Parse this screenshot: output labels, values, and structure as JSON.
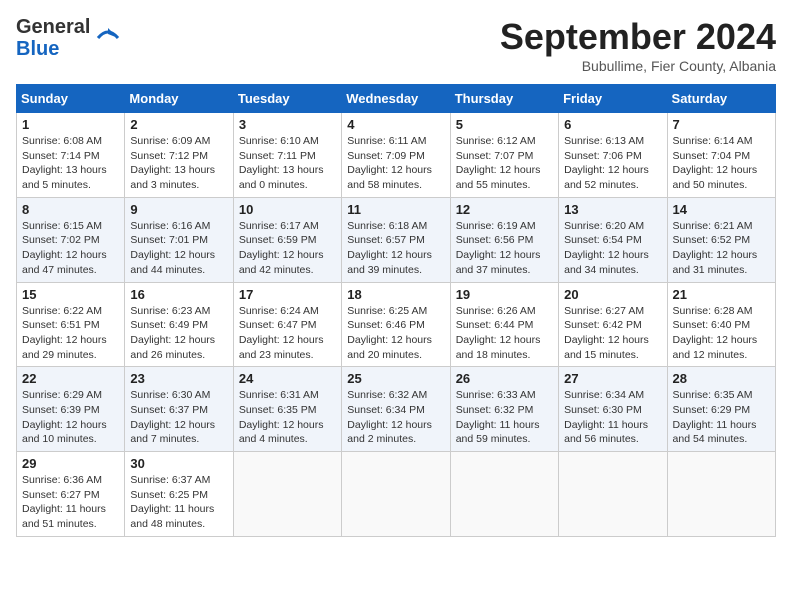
{
  "header": {
    "logo_general": "General",
    "logo_blue": "Blue",
    "month": "September 2024",
    "location": "Bubullime, Fier County, Albania"
  },
  "columns": [
    "Sunday",
    "Monday",
    "Tuesday",
    "Wednesday",
    "Thursday",
    "Friday",
    "Saturday"
  ],
  "weeks": [
    [
      {
        "day": "1",
        "info": "Sunrise: 6:08 AM\nSunset: 7:14 PM\nDaylight: 13 hours\nand 5 minutes."
      },
      {
        "day": "2",
        "info": "Sunrise: 6:09 AM\nSunset: 7:12 PM\nDaylight: 13 hours\nand 3 minutes."
      },
      {
        "day": "3",
        "info": "Sunrise: 6:10 AM\nSunset: 7:11 PM\nDaylight: 13 hours\nand 0 minutes."
      },
      {
        "day": "4",
        "info": "Sunrise: 6:11 AM\nSunset: 7:09 PM\nDaylight: 12 hours\nand 58 minutes."
      },
      {
        "day": "5",
        "info": "Sunrise: 6:12 AM\nSunset: 7:07 PM\nDaylight: 12 hours\nand 55 minutes."
      },
      {
        "day": "6",
        "info": "Sunrise: 6:13 AM\nSunset: 7:06 PM\nDaylight: 12 hours\nand 52 minutes."
      },
      {
        "day": "7",
        "info": "Sunrise: 6:14 AM\nSunset: 7:04 PM\nDaylight: 12 hours\nand 50 minutes."
      }
    ],
    [
      {
        "day": "8",
        "info": "Sunrise: 6:15 AM\nSunset: 7:02 PM\nDaylight: 12 hours\nand 47 minutes."
      },
      {
        "day": "9",
        "info": "Sunrise: 6:16 AM\nSunset: 7:01 PM\nDaylight: 12 hours\nand 44 minutes."
      },
      {
        "day": "10",
        "info": "Sunrise: 6:17 AM\nSunset: 6:59 PM\nDaylight: 12 hours\nand 42 minutes."
      },
      {
        "day": "11",
        "info": "Sunrise: 6:18 AM\nSunset: 6:57 PM\nDaylight: 12 hours\nand 39 minutes."
      },
      {
        "day": "12",
        "info": "Sunrise: 6:19 AM\nSunset: 6:56 PM\nDaylight: 12 hours\nand 37 minutes."
      },
      {
        "day": "13",
        "info": "Sunrise: 6:20 AM\nSunset: 6:54 PM\nDaylight: 12 hours\nand 34 minutes."
      },
      {
        "day": "14",
        "info": "Sunrise: 6:21 AM\nSunset: 6:52 PM\nDaylight: 12 hours\nand 31 minutes."
      }
    ],
    [
      {
        "day": "15",
        "info": "Sunrise: 6:22 AM\nSunset: 6:51 PM\nDaylight: 12 hours\nand 29 minutes."
      },
      {
        "day": "16",
        "info": "Sunrise: 6:23 AM\nSunset: 6:49 PM\nDaylight: 12 hours\nand 26 minutes."
      },
      {
        "day": "17",
        "info": "Sunrise: 6:24 AM\nSunset: 6:47 PM\nDaylight: 12 hours\nand 23 minutes."
      },
      {
        "day": "18",
        "info": "Sunrise: 6:25 AM\nSunset: 6:46 PM\nDaylight: 12 hours\nand 20 minutes."
      },
      {
        "day": "19",
        "info": "Sunrise: 6:26 AM\nSunset: 6:44 PM\nDaylight: 12 hours\nand 18 minutes."
      },
      {
        "day": "20",
        "info": "Sunrise: 6:27 AM\nSunset: 6:42 PM\nDaylight: 12 hours\nand 15 minutes."
      },
      {
        "day": "21",
        "info": "Sunrise: 6:28 AM\nSunset: 6:40 PM\nDaylight: 12 hours\nand 12 minutes."
      }
    ],
    [
      {
        "day": "22",
        "info": "Sunrise: 6:29 AM\nSunset: 6:39 PM\nDaylight: 12 hours\nand 10 minutes."
      },
      {
        "day": "23",
        "info": "Sunrise: 6:30 AM\nSunset: 6:37 PM\nDaylight: 12 hours\nand 7 minutes."
      },
      {
        "day": "24",
        "info": "Sunrise: 6:31 AM\nSunset: 6:35 PM\nDaylight: 12 hours\nand 4 minutes."
      },
      {
        "day": "25",
        "info": "Sunrise: 6:32 AM\nSunset: 6:34 PM\nDaylight: 12 hours\nand 2 minutes."
      },
      {
        "day": "26",
        "info": "Sunrise: 6:33 AM\nSunset: 6:32 PM\nDaylight: 11 hours\nand 59 minutes."
      },
      {
        "day": "27",
        "info": "Sunrise: 6:34 AM\nSunset: 6:30 PM\nDaylight: 11 hours\nand 56 minutes."
      },
      {
        "day": "28",
        "info": "Sunrise: 6:35 AM\nSunset: 6:29 PM\nDaylight: 11 hours\nand 54 minutes."
      }
    ],
    [
      {
        "day": "29",
        "info": "Sunrise: 6:36 AM\nSunset: 6:27 PM\nDaylight: 11 hours\nand 51 minutes."
      },
      {
        "day": "30",
        "info": "Sunrise: 6:37 AM\nSunset: 6:25 PM\nDaylight: 11 hours\nand 48 minutes."
      },
      {
        "day": "",
        "info": ""
      },
      {
        "day": "",
        "info": ""
      },
      {
        "day": "",
        "info": ""
      },
      {
        "day": "",
        "info": ""
      },
      {
        "day": "",
        "info": ""
      }
    ]
  ]
}
